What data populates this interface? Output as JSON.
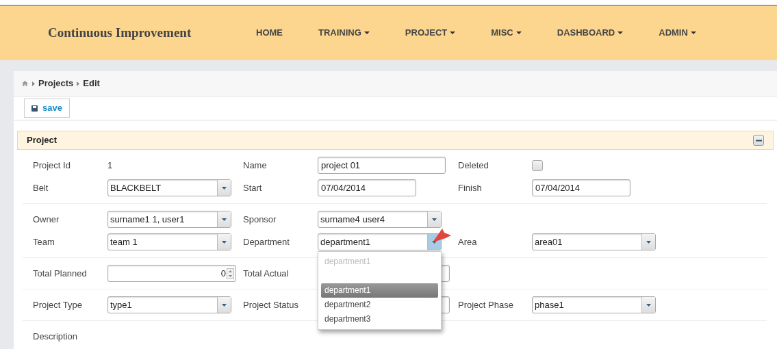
{
  "navbar": {
    "brand": "Continuous Improvement",
    "items": [
      {
        "label": "HOME",
        "has_menu": false
      },
      {
        "label": "TRAINING",
        "has_menu": true
      },
      {
        "label": "PROJECT",
        "has_menu": true
      },
      {
        "label": "MISC",
        "has_menu": true
      },
      {
        "label": "DASHBOARD",
        "has_menu": true
      },
      {
        "label": "ADMIN",
        "has_menu": true
      }
    ]
  },
  "breadcrumb": [
    "Projects",
    "Edit"
  ],
  "toolbar": {
    "save": "save"
  },
  "section": {
    "title": "Project",
    "expanded": true,
    "groups": [
      [
        [
          {
            "label": "Project Id",
            "kind": "static",
            "value": "1"
          },
          {
            "label": "Name",
            "kind": "text",
            "value": "project 01"
          },
          {
            "label": "Deleted",
            "kind": "checkbox",
            "checked": false
          }
        ],
        [
          {
            "label": "Belt",
            "kind": "select",
            "value": "BLACKBELT"
          },
          {
            "label": "Start",
            "kind": "date",
            "value": "07/04/2014"
          },
          {
            "label": "Finish",
            "kind": "date",
            "value": "07/04/2014"
          }
        ]
      ],
      [
        [
          {
            "label": "Owner",
            "kind": "select",
            "value": "surname1 1, user1"
          },
          {
            "label": "Sponsor",
            "kind": "select",
            "value": "surname4 user4"
          }
        ],
        [
          {
            "label": "Team",
            "kind": "select",
            "value": "team 1"
          },
          {
            "label": "Department",
            "kind": "select",
            "value": "department1",
            "open": true
          },
          {
            "label": "Area",
            "kind": "select",
            "value": "area01"
          }
        ]
      ],
      [
        [
          {
            "label": "Total Planned",
            "kind": "number",
            "value": "0"
          },
          {
            "label": "Total Actual",
            "kind": "hidden"
          }
        ]
      ],
      [
        [
          {
            "label": "Project Type",
            "kind": "select",
            "value": "type1"
          },
          {
            "label": "Project Status",
            "kind": "hidden"
          },
          {
            "label": "Project Phase",
            "kind": "select",
            "value": "phase1"
          }
        ]
      ],
      [
        [
          {
            "label": "Description",
            "kind": "none"
          }
        ]
      ]
    ]
  },
  "dropdown": {
    "options": [
      {
        "label": "department1",
        "disabled": true,
        "selected": false
      },
      {
        "label": "department1",
        "disabled": false,
        "selected": true
      },
      {
        "label": "department2",
        "disabled": false,
        "selected": false
      },
      {
        "label": "department3",
        "disabled": false,
        "selected": false
      }
    ]
  }
}
